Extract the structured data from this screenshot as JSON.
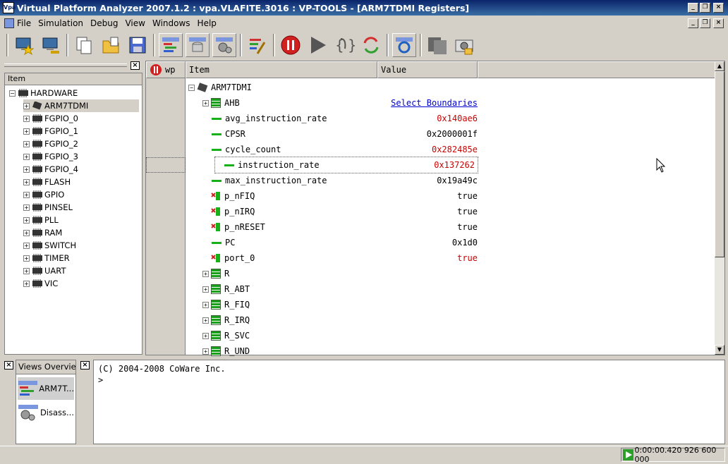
{
  "window": {
    "title": "Virtual Platform Analyzer 2007.1.2 : vpa.VLAFITE.3016 : VP-TOOLS - [ARM7TDMI Registers]",
    "app_icon": "Vpa"
  },
  "menu": [
    "File",
    "Simulation",
    "Debug",
    "View",
    "Windows",
    "Help"
  ],
  "toolbar_icons": [
    "new-monitor-star-icon",
    "network-monitor-icon",
    "copy-documents-icon",
    "open-folder-icon",
    "save-icon",
    "views-icon",
    "database-icon",
    "settings-icon",
    "brush-icon",
    "stop-icon",
    "run-icon",
    "step-icon",
    "restart-icon",
    "refresh-icon",
    "grey-squares-icon",
    "camera-icon"
  ],
  "tree": {
    "column_header": "Item",
    "root": "HARDWARE",
    "items": [
      "ARM7TDMI",
      "FGPIO_0",
      "FGPIO_1",
      "FGPIO_2",
      "FGPIO_3",
      "FGPIO_4",
      "FLASH",
      "GPIO",
      "PINSEL",
      "PLL",
      "RAM",
      "SWITCH",
      "TIMER",
      "UART",
      "VIC"
    ],
    "selected": "ARM7TDMI"
  },
  "grid": {
    "headers": {
      "wp": "wp",
      "item": "Item",
      "value": "Value"
    },
    "root": "ARM7TDMI",
    "rows": [
      {
        "name": "AHB",
        "icon": "register-group",
        "expandable": true,
        "value": "Select Boundaries",
        "value_style": "link"
      },
      {
        "name": "avg_instruction_rate",
        "icon": "dash",
        "value": "0x140ae6",
        "value_style": "red"
      },
      {
        "name": "CPSR",
        "icon": "dash",
        "value": "0x2000001f",
        "value_style": "normal"
      },
      {
        "name": "cycle_count",
        "icon": "dash",
        "value": "0x282485e",
        "value_style": "red"
      },
      {
        "name": "instruction_rate",
        "icon": "dash",
        "value": "0x137262",
        "value_style": "red",
        "focused": true
      },
      {
        "name": "max_instruction_rate",
        "icon": "dash",
        "value": "0x19a49c",
        "value_style": "normal"
      },
      {
        "name": "p_nFIQ",
        "icon": "port",
        "value": "true",
        "value_style": "normal"
      },
      {
        "name": "p_nIRQ",
        "icon": "port",
        "value": "true",
        "value_style": "normal"
      },
      {
        "name": "p_nRESET",
        "icon": "port",
        "value": "true",
        "value_style": "normal"
      },
      {
        "name": "PC",
        "icon": "dash",
        "value": "0x1d0",
        "value_style": "normal"
      },
      {
        "name": "port_0",
        "icon": "port",
        "value": "true",
        "value_style": "red"
      },
      {
        "name": "R",
        "icon": "register-group",
        "expandable": true,
        "value": ""
      },
      {
        "name": "R_ABT",
        "icon": "register-group",
        "expandable": true,
        "value": ""
      },
      {
        "name": "R_FIQ",
        "icon": "register-group",
        "expandable": true,
        "value": ""
      },
      {
        "name": "R_IRQ",
        "icon": "register-group",
        "expandable": true,
        "value": ""
      },
      {
        "name": "R_SVC",
        "icon": "register-group",
        "expandable": true,
        "value": ""
      },
      {
        "name": "R_UND",
        "icon": "register-group",
        "expandable": true,
        "value": ""
      }
    ]
  },
  "views_overview": {
    "title": "Views Overvie",
    "items": [
      "ARM7T...",
      "Disass..."
    ]
  },
  "console": {
    "lines": [
      "(C) 2004-2008 CoWare Inc.",
      ">"
    ]
  },
  "status": {
    "time": "0:00:00.420 926 600 000"
  },
  "colors": {
    "title_start": "#0a246a",
    "title_end": "#3a6ea5",
    "value_red": "#cc0000",
    "link_blue": "#0000cc",
    "register_green": "#18b018"
  }
}
